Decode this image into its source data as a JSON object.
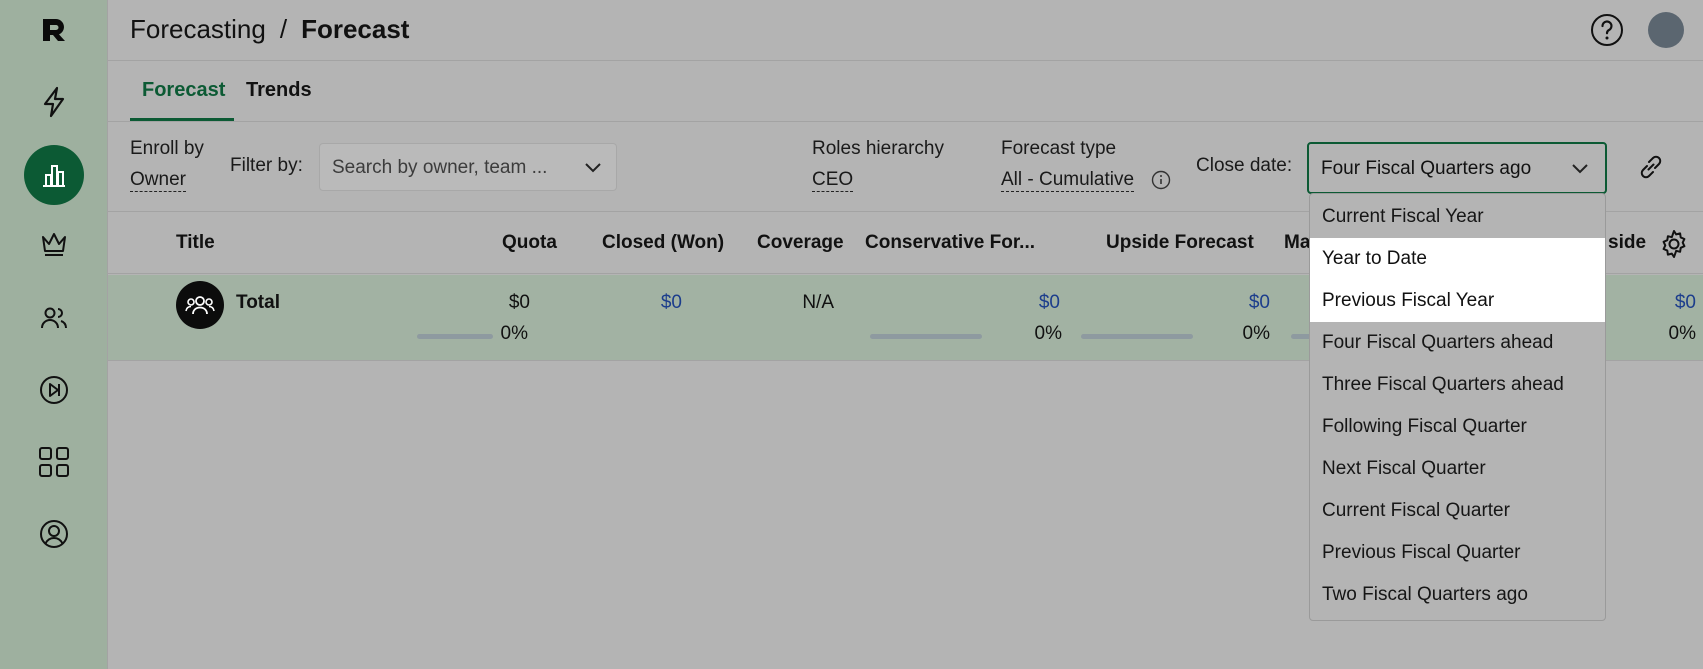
{
  "breadcrumb": {
    "parent": "Forecasting",
    "separator": "/",
    "current": "Forecast"
  },
  "tabs": [
    {
      "label": "Forecast",
      "active": true
    },
    {
      "label": "Trends",
      "active": false
    }
  ],
  "filters": {
    "enroll_label": "Enroll by",
    "enroll_value": "Owner",
    "filter_label": "Filter by:",
    "search_placeholder": "Search by owner, team ...",
    "roles_label": "Roles hierarchy",
    "roles_value": "CEO",
    "forecast_type_label": "Forecast type",
    "forecast_type_value": "All - Cumulative",
    "close_date_label": "Close date:",
    "close_date_value": "Four Fiscal Quarters ago"
  },
  "table": {
    "headers": {
      "title": "Title",
      "quota": "Quota",
      "closed": "Closed (Won)",
      "coverage": "Coverage",
      "conservative": "Conservative For...",
      "upside": "Upside Forecast",
      "ma_partial": "Ma",
      "side_partial": "side"
    },
    "total_row": {
      "title": "Total",
      "quota": "$0",
      "quota_pct": "0%",
      "closed": "$0",
      "coverage": "N/A",
      "conservative": "$0",
      "conservative_pct": "0%",
      "upside": "$0",
      "upside_pct": "0%",
      "last": "$0",
      "last_pct": "0%"
    }
  },
  "dropdown": {
    "options": [
      "Current Fiscal Year",
      "Year to Date",
      "Previous Fiscal Year",
      "Four Fiscal Quarters ahead",
      "Three Fiscal Quarters ahead",
      "Following Fiscal Quarter",
      "Next Fiscal Quarter",
      "Current Fiscal Quarter",
      "Previous Fiscal Quarter",
      "Two Fiscal Quarters ago"
    ],
    "highlighted": [
      "Year to Date",
      "Previous Fiscal Year"
    ]
  },
  "colors": {
    "brand": "#0c5a34",
    "link_value": "#1c3d8c",
    "sidebar": "#9eb09f",
    "overlay_bg": "#b4b4b4"
  },
  "icons": [
    "logo-icon",
    "bolt-icon",
    "bar-chart-icon",
    "crown-icon",
    "people-icon",
    "play-skip-icon",
    "apps-grid-icon",
    "user-circle-icon",
    "help-icon",
    "chevron-down-icon",
    "info-icon",
    "link-icon",
    "gear-icon",
    "team-icon"
  ]
}
